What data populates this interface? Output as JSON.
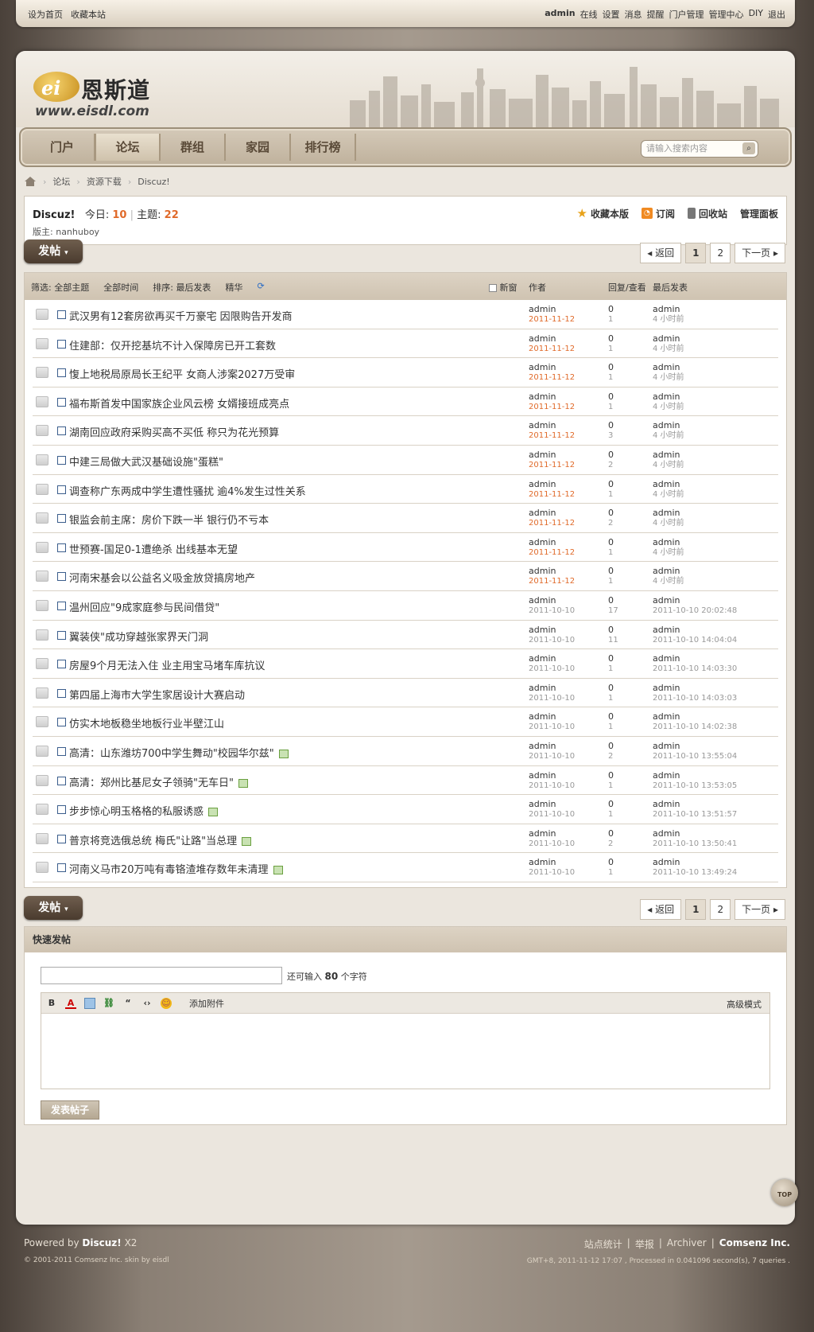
{
  "topbar": {
    "left": [
      "设为首页",
      "收藏本站"
    ],
    "user": "admin",
    "right": [
      "在线",
      "设置",
      "消息",
      "提醒",
      "门户管理",
      "管理中心",
      "DIY",
      "退出"
    ]
  },
  "logo": {
    "mark": "ei",
    "cn": "恩斯道",
    "en": "www.eisdl.com"
  },
  "nav": [
    "门户",
    "论坛",
    "群组",
    "家园",
    "排行榜"
  ],
  "search": {
    "placeholder": "请输入搜索内容"
  },
  "breadcrumb": [
    "论坛",
    "资源下载",
    "Discuz!"
  ],
  "forum": {
    "name": "Discuz!",
    "today_label": "今日:",
    "today": "10",
    "topics_label": "主题:",
    "topics": "22",
    "mods_label": "版主:",
    "mods": "nanhuboy",
    "actions": [
      "收藏本版",
      "订阅",
      "回收站",
      "管理面板"
    ]
  },
  "post_button": "发帖",
  "pager": {
    "back": "返回",
    "pages": [
      "1",
      "2"
    ],
    "next": "下一页"
  },
  "thead": {
    "filter_label": "筛选:",
    "all_topics": "全部主题",
    "all_time": "全部时间",
    "sort_label": "排序:",
    "sort": "最后发表",
    "digest": "精华",
    "new_window": "新窗",
    "author": "作者",
    "replies": "回复/查看",
    "last": "最后发表"
  },
  "threads": [
    {
      "s": "武汉男有12套房欲再买千万豪宅 因限购告开发商",
      "a": "admin",
      "d": "2011-11-12",
      "r": "0",
      "v": "1",
      "la": "admin",
      "lt": "4 小时前",
      "img": false,
      "new": true
    },
    {
      "s": "住建部：仅开挖基坑不计入保障房已开工套数",
      "a": "admin",
      "d": "2011-11-12",
      "r": "0",
      "v": "1",
      "la": "admin",
      "lt": "4 小时前",
      "img": false,
      "new": true
    },
    {
      "s": "愎上地税局原局长王纪平 女商人涉案2027万受审",
      "a": "admin",
      "d": "2011-11-12",
      "r": "0",
      "v": "1",
      "la": "admin",
      "lt": "4 小时前",
      "img": false,
      "new": true
    },
    {
      "s": "福布斯首发中国家族企业风云榜 女婿接班成亮点",
      "a": "admin",
      "d": "2011-11-12",
      "r": "0",
      "v": "1",
      "la": "admin",
      "lt": "4 小时前",
      "img": false,
      "new": true
    },
    {
      "s": "湖南回应政府采购买高不买低 称只为花光预算",
      "a": "admin",
      "d": "2011-11-12",
      "r": "0",
      "v": "3",
      "la": "admin",
      "lt": "4 小时前",
      "img": false,
      "new": true
    },
    {
      "s": "中建三局做大武汉基础设施\"蛋糕\"",
      "a": "admin",
      "d": "2011-11-12",
      "r": "0",
      "v": "2",
      "la": "admin",
      "lt": "4 小时前",
      "img": false,
      "new": true
    },
    {
      "s": "调查称广东两成中学生遭性骚扰 逾4%发生过性关系",
      "a": "admin",
      "d": "2011-11-12",
      "r": "0",
      "v": "1",
      "la": "admin",
      "lt": "4 小时前",
      "img": false,
      "new": true
    },
    {
      "s": "银监会前主席：房价下跌一半 银行仍不亏本",
      "a": "admin",
      "d": "2011-11-12",
      "r": "0",
      "v": "2",
      "la": "admin",
      "lt": "4 小时前",
      "img": false,
      "new": true
    },
    {
      "s": "世预赛-国足0-1遭绝杀 出线基本无望",
      "a": "admin",
      "d": "2011-11-12",
      "r": "0",
      "v": "1",
      "la": "admin",
      "lt": "4 小时前",
      "img": false,
      "new": true
    },
    {
      "s": "河南宋基会以公益名义吸金放贷搞房地产",
      "a": "admin",
      "d": "2011-11-12",
      "r": "0",
      "v": "1",
      "la": "admin",
      "lt": "4 小时前",
      "img": false,
      "new": true
    },
    {
      "s": "温州回应\"9成家庭参与民间借贷\"",
      "a": "admin",
      "d": "2011-10-10",
      "r": "0",
      "v": "17",
      "la": "admin",
      "lt": "2011-10-10 20:02:48",
      "img": false,
      "new": false
    },
    {
      "s": "翼装侠\"成功穿越张家界天门洞",
      "a": "admin",
      "d": "2011-10-10",
      "r": "0",
      "v": "11",
      "la": "admin",
      "lt": "2011-10-10 14:04:04",
      "img": false,
      "new": false
    },
    {
      "s": "房屋9个月无法入住 业主用宝马堵车库抗议",
      "a": "admin",
      "d": "2011-10-10",
      "r": "0",
      "v": "1",
      "la": "admin",
      "lt": "2011-10-10 14:03:30",
      "img": false,
      "new": false
    },
    {
      "s": "第四届上海市大学生家居设计大赛启动",
      "a": "admin",
      "d": "2011-10-10",
      "r": "0",
      "v": "1",
      "la": "admin",
      "lt": "2011-10-10 14:03:03",
      "img": false,
      "new": false
    },
    {
      "s": "仿实木地板稳坐地板行业半壁江山",
      "a": "admin",
      "d": "2011-10-10",
      "r": "0",
      "v": "1",
      "la": "admin",
      "lt": "2011-10-10 14:02:38",
      "img": false,
      "new": false
    },
    {
      "s": "高清：山东潍坊700中学生舞动\"校园华尔兹\"",
      "a": "admin",
      "d": "2011-10-10",
      "r": "0",
      "v": "2",
      "la": "admin",
      "lt": "2011-10-10 13:55:04",
      "img": true,
      "new": false
    },
    {
      "s": "高清：郑州比基尼女子领骑\"无车日\"",
      "a": "admin",
      "d": "2011-10-10",
      "r": "0",
      "v": "1",
      "la": "admin",
      "lt": "2011-10-10 13:53:05",
      "img": true,
      "new": false
    },
    {
      "s": "步步惊心明玉格格的私服诱惑",
      "a": "admin",
      "d": "2011-10-10",
      "r": "0",
      "v": "1",
      "la": "admin",
      "lt": "2011-10-10 13:51:57",
      "img": true,
      "new": false
    },
    {
      "s": "普京将竞选俄总统 梅氏\"让路\"当总理",
      "a": "admin",
      "d": "2011-10-10",
      "r": "0",
      "v": "2",
      "la": "admin",
      "lt": "2011-10-10 13:50:41",
      "img": true,
      "new": false
    },
    {
      "s": "河南义马市20万吨有毒铬渣堆存数年未清理",
      "a": "admin",
      "d": "2011-10-10",
      "r": "0",
      "v": "1",
      "la": "admin",
      "lt": "2011-10-10 13:49:24",
      "img": true,
      "new": false
    }
  ],
  "quick": {
    "title": "快速发帖",
    "remain_prefix": "还可输入",
    "remain": "80",
    "remain_suffix": "个字符",
    "attach": "添加附件",
    "advanced": "高级模式",
    "submit": "发表帖子"
  },
  "totop": "TOP",
  "footer": {
    "powered": "Powered by",
    "product": "Discuz!",
    "version": "X2",
    "copyright": "© 2001-2011 Comsenz Inc. skin by eisdl",
    "links": [
      "站点统计",
      "举报",
      "Archiver"
    ],
    "company": "Comsenz Inc.",
    "processed": "GMT+8, 2011-11-12 17:07 , Processed in 0.041096 second(s), 7 queries ."
  }
}
